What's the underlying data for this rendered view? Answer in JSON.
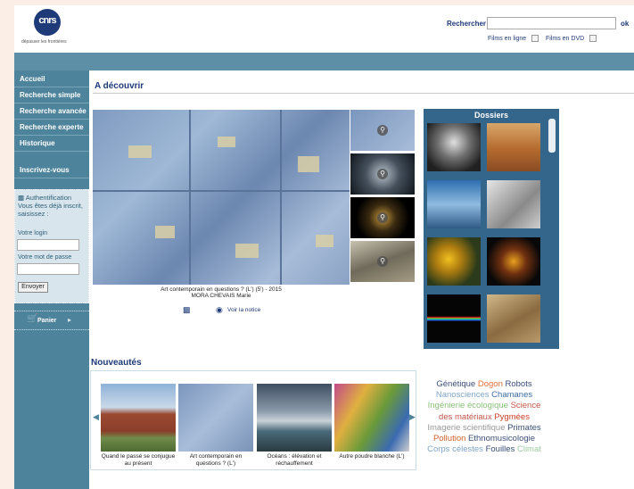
{
  "header": {
    "logo_text": "cnrs",
    "tagline": "dépasser les frontières",
    "search_label": "Rechercher",
    "search_value": "",
    "search_submit": "ok",
    "filter_online": "Films en ligne",
    "filter_dvd": "Films en DVD"
  },
  "sidebar": {
    "items": [
      {
        "label": "Accueil"
      },
      {
        "label": "Recherche simple"
      },
      {
        "label": "Recherche avancée"
      },
      {
        "label": "Recherche experte"
      },
      {
        "label": "Historique"
      },
      {
        "label": "Inscrivez-vous"
      }
    ],
    "auth": {
      "title": "Authentification Vous êtes déjà inscrit, saisissez :",
      "login_label": "Votre login",
      "password_label": "Votre mot de passe",
      "submit": "Envoyer"
    },
    "cart_label": "Panier"
  },
  "discover": {
    "title": "A découvrir",
    "caption_line1": "Art contemporain en questions ? (L') (5') - 2015",
    "caption_line2": "MORA CHEVAIS Marie",
    "notice_link": "Voir la notice"
  },
  "dossiers": {
    "title": "Dossiers"
  },
  "news": {
    "title": "Nouveautés",
    "items": [
      {
        "caption": "Quand le passé se conjugue au présent"
      },
      {
        "caption": "Art contemporain en questions ? (L')"
      },
      {
        "caption": "Océans : élévation et réchauffement"
      },
      {
        "caption": "Autre poudre blanche (L')"
      }
    ]
  },
  "tags": [
    {
      "label": "Génétique",
      "color": "#3a4f7a"
    },
    {
      "label": "Dogon",
      "color": "#e0703a"
    },
    {
      "label": "Robots",
      "color": "#3a4f7a"
    },
    {
      "label": "Nanosciences",
      "color": "#7fa7cc"
    },
    {
      "label": "Chamanes",
      "color": "#3a6ea5"
    },
    {
      "label": "Ingénierie écologique",
      "color": "#8cc07a"
    },
    {
      "label": "Science des matériaux",
      "color": "#c4564a"
    },
    {
      "label": "Pygmées",
      "color": "#d0402a"
    },
    {
      "label": "Imagerie scientifique",
      "color": "#999999"
    },
    {
      "label": "Primates",
      "color": "#3a4f7a"
    },
    {
      "label": "Pollution",
      "color": "#d0602a"
    },
    {
      "label": "Ethnomusicologie",
      "color": "#3a4f7a"
    },
    {
      "label": "Corps célestes",
      "color": "#7fa7cc"
    },
    {
      "label": "Fouilles",
      "color": "#3a4f7a"
    },
    {
      "label": "Climat",
      "color": "#9ccba0"
    }
  ]
}
